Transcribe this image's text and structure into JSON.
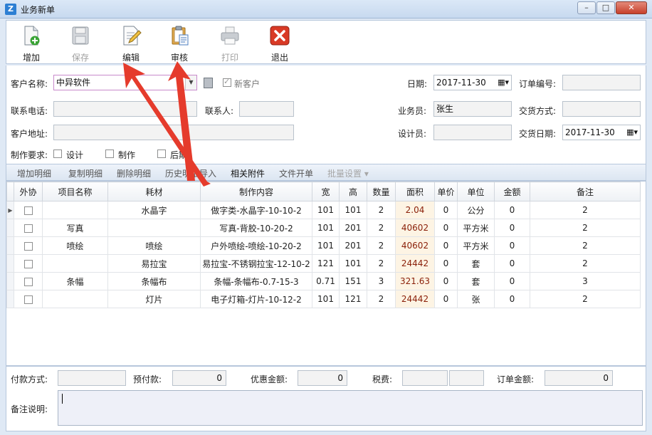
{
  "window": {
    "title": "业务新单",
    "controls": {
      "minimize": "–",
      "maximize": "□",
      "close": "✕"
    }
  },
  "toolbar": {
    "buttons": [
      {
        "label": "增加",
        "icon": "add-document-icon",
        "enabled": true
      },
      {
        "label": "保存",
        "icon": "floppy-disk-icon",
        "enabled": false
      },
      {
        "label": "编辑",
        "icon": "edit-document-icon",
        "enabled": true
      },
      {
        "label": "审核",
        "icon": "clipboard-review-icon",
        "enabled": true
      },
      {
        "label": "打印",
        "icon": "printer-icon",
        "enabled": false
      },
      {
        "label": "退出",
        "icon": "exit-x-icon",
        "enabled": true
      }
    ]
  },
  "form": {
    "customer_name_label": "客户名称:",
    "customer_name_value": "中异软件",
    "new_customer_label": "新客户",
    "date_label": "日期:",
    "date_value": "2017-11-30",
    "order_no_label": "订单编号:",
    "order_no_value": "",
    "phone_label": "联系电话:",
    "phone_value": "",
    "contact_label": "联系人:",
    "contact_value": "",
    "salesperson_label": "业务员:",
    "salesperson_value": "张生",
    "delivery_method_label": "交货方式:",
    "delivery_method_value": "",
    "address_label": "客户地址:",
    "address_value": "",
    "designer_label": "设计员:",
    "designer_value": "",
    "delivery_date_label": "交货日期:",
    "delivery_date_value": "2017-11-30",
    "requirements_label": "制作要求:",
    "req_design": "设计",
    "req_production": "制作",
    "req_post": "后期"
  },
  "subtoolbar": {
    "items": [
      {
        "label": "增加明细",
        "state": "normal"
      },
      {
        "label": "复制明细",
        "state": "normal"
      },
      {
        "label": "删除明细",
        "state": "normal"
      },
      {
        "label": "历史明细导入",
        "state": "normal"
      },
      {
        "label": "相关附件",
        "state": "active"
      },
      {
        "label": "文件开单",
        "state": "normal"
      },
      {
        "label": "批量设置 ▾",
        "state": "disabled"
      }
    ]
  },
  "grid": {
    "columns": [
      "外协",
      "项目名称",
      "耗材",
      "制作内容",
      "宽",
      "高",
      "数量",
      "面积",
      "单价",
      "单位",
      "金额",
      "备注"
    ],
    "rows": [
      {
        "item": "",
        "material": "水晶字",
        "content": "做字类-水晶字-10-10-2",
        "w": "101",
        "h": "101",
        "qty": "2",
        "area": "2.04",
        "price": "0",
        "unit": "公分",
        "amount": "0",
        "note": "2"
      },
      {
        "item": "写真",
        "material": "",
        "content": "写真-背胶-10-20-2",
        "w": "101",
        "h": "201",
        "qty": "2",
        "area": "40602",
        "price": "0",
        "unit": "平方米",
        "amount": "0",
        "note": "2"
      },
      {
        "item": "喷绘",
        "material": "喷绘",
        "content": "户外喷绘-喷绘-10-20-2",
        "w": "101",
        "h": "201",
        "qty": "2",
        "area": "40602",
        "price": "0",
        "unit": "平方米",
        "amount": "0",
        "note": "2"
      },
      {
        "item": "",
        "material": "易拉宝",
        "content": "易拉宝-不锈钢拉宝-12-10-2",
        "w": "121",
        "h": "101",
        "qty": "2",
        "area": "24442",
        "price": "0",
        "unit": "套",
        "amount": "0",
        "note": "2"
      },
      {
        "item": "条幅",
        "material": "条幅布",
        "content": "条幅-条幅布-0.7-15-3",
        "w": "0.71",
        "h": "151",
        "qty": "3",
        "area": "321.63",
        "price": "0",
        "unit": "套",
        "amount": "0",
        "note": "3"
      },
      {
        "item": "",
        "material": "灯片",
        "content": "电子灯箱-灯片-10-12-2",
        "w": "101",
        "h": "121",
        "qty": "2",
        "area": "24442",
        "price": "0",
        "unit": "张",
        "amount": "0",
        "note": "2"
      }
    ]
  },
  "footer": {
    "payment_method_label": "付款方式:",
    "payment_method_value": "",
    "prepaid_label": "预付款:",
    "prepaid_value": "0",
    "discount_label": "优惠金额:",
    "discount_value": "0",
    "tax_label": "税费:",
    "tax_value": "",
    "order_amount_label": "订单金额:",
    "order_amount_value": "0",
    "notes_label": "备注说明:",
    "notes_value": ""
  },
  "colors": {
    "annotation_arrow": "#e53b2c",
    "area_cell_bg": "#fdf4e4",
    "title_bar": "#c7d9ef"
  }
}
